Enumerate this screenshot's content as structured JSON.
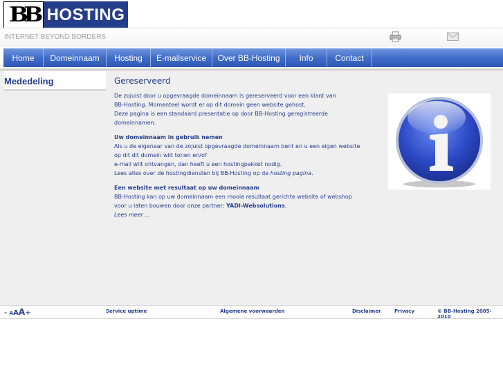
{
  "header": {
    "logo_mark": "BB",
    "logo_text": "HOSTING",
    "tagline": "INTERNET BEYOND BORDERS"
  },
  "icons": {
    "print": "printer-icon",
    "mail": "envelope-icon"
  },
  "nav": {
    "items": [
      "Home",
      "Domeinnaam",
      "Hosting",
      "E-mailservice",
      "Over BB-Hosting",
      "Info",
      "Contact"
    ]
  },
  "sidebar": {
    "title": "Mededeling"
  },
  "main": {
    "title": "Gereserveerd",
    "intro_1": "De zojuist door u opgevraagde domeinnaam is gereserveerd voor een klant van",
    "intro_2": "BB-Hosting. Momenteel wordt er op dit domein geen website gehost.",
    "intro_3": "Deze pagina is een standaard presentatie op door BB-Hosting geregistreerde",
    "intro_4": "domeinnamen.",
    "section1_title": "Uw domeinnaam in gebruik nemen",
    "s1_line1": "Als u de eigenaar van de zojuist opgevraagde domeinnaam bent en u een eigen website",
    "s1_line2": "op dit dit domein wilt tonen en/of",
    "s1_line3": "e-mail wilt ontvangen, dan heeft u een hostingpakket nodig.",
    "s1_line4_pre": "Lees alles over de hostingdiensten bij BB-Hosting op de ",
    "s1_link": "hosting pagina",
    "s1_line4_post": ".",
    "section2_title": "Een website met resultaat op uw domeinnaam",
    "s2_line1": "BB-Hosting kan op uw domeinnaam een mooie resultaat gerichte website of webshop",
    "s2_line2_pre": "voor u laten bouwen door onze partner: ",
    "s2_partner": "YADI-Websolutions",
    "s2_line2_post": ".",
    "read_more": "Lees meer ..."
  },
  "info_image": {
    "icon": "info-icon",
    "symbol": "i"
  },
  "footer": {
    "sizes_prefix": "-",
    "size_small": "A",
    "size_medium": "A",
    "size_large": "A",
    "sizes_suffix": "+",
    "service_uptime": "Service uptime",
    "terms": "Algemene voorwaarden",
    "disclaimer": "Disclaimer",
    "privacy": "Privacy",
    "copyright": "© BB-Hosting 2005-2010"
  },
  "colors": {
    "brand_blue": "#253e8c",
    "nav_blue": "#3e6ac6",
    "content_bg": "#efefef"
  }
}
